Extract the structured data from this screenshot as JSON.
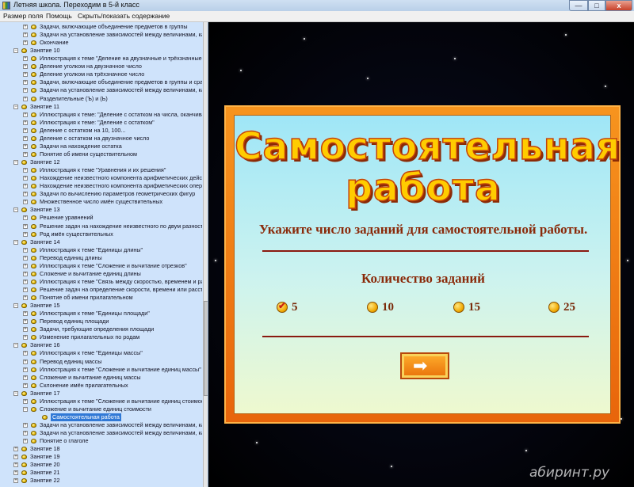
{
  "window": {
    "title": "Летняя школа. Переходим в 5-й класс",
    "min_glyph": "—",
    "max_glyph": "□",
    "close_glyph": "x"
  },
  "menu": [
    "Размер поля",
    "Помощь",
    "Скрыть/показать содержание"
  ],
  "tree": [
    {
      "level": 2,
      "expander": "+",
      "label": "Задачи, включающие объединение предметов в группы"
    },
    {
      "level": 2,
      "expander": "+",
      "label": "Задачи на установление зависимостей между величинами, кара"
    },
    {
      "level": 2,
      "expander": "+",
      "label": "Окончание"
    },
    {
      "level": 1,
      "expander": "−",
      "label": "Занятие 10"
    },
    {
      "level": 2,
      "expander": "+",
      "label": "Иллюстрация к теме \"Деление на двузначные и трёхзначные чис"
    },
    {
      "level": 2,
      "expander": "+",
      "label": "Деление уголком на двузначное число"
    },
    {
      "level": 2,
      "expander": "+",
      "label": "Деление уголком на трёхзначное число"
    },
    {
      "level": 2,
      "expander": "+",
      "label": "Задачи, включающие объединение предметов в группы и сравне"
    },
    {
      "level": 2,
      "expander": "+",
      "label": "Задачи на установление зависимостей между величинами, кара"
    },
    {
      "level": 2,
      "expander": "+",
      "label": "Разделительные (Ъ) и (Ь)"
    },
    {
      "level": 1,
      "expander": "−",
      "label": "Занятие 11"
    },
    {
      "level": 2,
      "expander": "+",
      "label": "Иллюстрация к теме: \"Деление с остатком на числа, оканчиваю"
    },
    {
      "level": 2,
      "expander": "+",
      "label": "Иллюстрация к теме: \"Деление с остатком\""
    },
    {
      "level": 2,
      "expander": "+",
      "label": "Деление с остатком на 10, 100..."
    },
    {
      "level": 2,
      "expander": "+",
      "label": "Деление с остатком на двузначное число"
    },
    {
      "level": 2,
      "expander": "+",
      "label": "Задачи на нахождение остатка"
    },
    {
      "level": 2,
      "expander": "+",
      "label": "Понятие об имени существительном"
    },
    {
      "level": 1,
      "expander": "−",
      "label": "Занятие 12"
    },
    {
      "level": 2,
      "expander": "+",
      "label": "Иллюстрация к теме \"Уравнения и их решения\""
    },
    {
      "level": 2,
      "expander": "+",
      "label": "Нахождение неизвестного компонента арифметических действ"
    },
    {
      "level": 2,
      "expander": "+",
      "label": "Нахождение неизвестного компонента арифметических операц"
    },
    {
      "level": 2,
      "expander": "+",
      "label": "Задачи по вычислению параметров геометрических фигур"
    },
    {
      "level": 2,
      "expander": "+",
      "label": "Множественное число имён существительных"
    },
    {
      "level": 1,
      "expander": "−",
      "label": "Занятие 13"
    },
    {
      "level": 2,
      "expander": "+",
      "label": "Решение уравнений"
    },
    {
      "level": 2,
      "expander": "+",
      "label": "Решение задач на нахождение неизвестного по двум разностям"
    },
    {
      "level": 2,
      "expander": "+",
      "label": "Род имён существительных"
    },
    {
      "level": 1,
      "expander": "−",
      "label": "Занятие 14"
    },
    {
      "level": 2,
      "expander": "+",
      "label": "Иллюстрация к теме \"Единицы длины\""
    },
    {
      "level": 2,
      "expander": "+",
      "label": "Перевод единиц длины"
    },
    {
      "level": 2,
      "expander": "+",
      "label": "Иллюстрация к теме \"Сложение и вычитание отрезков\""
    },
    {
      "level": 2,
      "expander": "+",
      "label": "Сложение и вычитание единиц длины"
    },
    {
      "level": 2,
      "expander": "+",
      "label": "Иллюстрация к теме \"Связь между скоростью, временем и рас"
    },
    {
      "level": 2,
      "expander": "+",
      "label": "Решение задач на определение скорости, времени или расстоян"
    },
    {
      "level": 2,
      "expander": "+",
      "label": "Понятие об имени прилагательном"
    },
    {
      "level": 1,
      "expander": "−",
      "label": "Занятие 15"
    },
    {
      "level": 2,
      "expander": "+",
      "label": "Иллюстрация к теме \"Единицы площади\""
    },
    {
      "level": 2,
      "expander": "+",
      "label": "Перевод единиц площади"
    },
    {
      "level": 2,
      "expander": "+",
      "label": "Задачи, требующие определения площади"
    },
    {
      "level": 2,
      "expander": "+",
      "label": "Изменение прилагательных по родам"
    },
    {
      "level": 1,
      "expander": "−",
      "label": "Занятие 16"
    },
    {
      "level": 2,
      "expander": "+",
      "label": "Иллюстрация к теме \"Единицы массы\""
    },
    {
      "level": 2,
      "expander": "+",
      "label": "Перевод единиц массы"
    },
    {
      "level": 2,
      "expander": "+",
      "label": "Иллюстрация к теме \"Сложение и вычитание единиц массы\""
    },
    {
      "level": 2,
      "expander": "+",
      "label": "Сложение и вычитание единиц массы"
    },
    {
      "level": 2,
      "expander": "+",
      "label": "Склонение имён прилагательных"
    },
    {
      "level": 1,
      "expander": "−",
      "label": "Занятие 17"
    },
    {
      "level": 2,
      "expander": "+",
      "label": "Иллюстрация к теме \"Сложение и вычитание единиц стоимости\""
    },
    {
      "level": 2,
      "expander": "−",
      "label": "Сложение и вычитание единиц стоимости"
    },
    {
      "level": 3,
      "expander": "",
      "label": "Самостоятельная работа",
      "selected": true
    },
    {
      "level": 2,
      "expander": "+",
      "label": "Задачи на установление зависимостей между величинами, кара"
    },
    {
      "level": 2,
      "expander": "+",
      "label": "Задачи на установление зависимостей между величинами, кара"
    },
    {
      "level": 2,
      "expander": "+",
      "label": "Понятие о глаголе"
    },
    {
      "level": 1,
      "expander": "+",
      "label": "Занятие 18"
    },
    {
      "level": 1,
      "expander": "+",
      "label": "Занятие 19"
    },
    {
      "level": 1,
      "expander": "+",
      "label": "Занятие 20"
    },
    {
      "level": 1,
      "expander": "+",
      "label": "Занятие 21"
    },
    {
      "level": 1,
      "expander": "+",
      "label": "Занятие 22"
    }
  ],
  "content": {
    "heading_line1": "Самостоятельная",
    "heading_line2": "работа",
    "instruction": "Укажите число заданий для самостоятельной работы.",
    "count_label": "Количество заданий",
    "options": [
      {
        "label": "5",
        "checked": true
      },
      {
        "label": "10",
        "checked": false
      },
      {
        "label": "15",
        "checked": false
      },
      {
        "label": "25",
        "checked": false
      }
    ],
    "next_glyph": "➡",
    "check_glyph": "✔"
  },
  "watermark": "абиринт.ру"
}
